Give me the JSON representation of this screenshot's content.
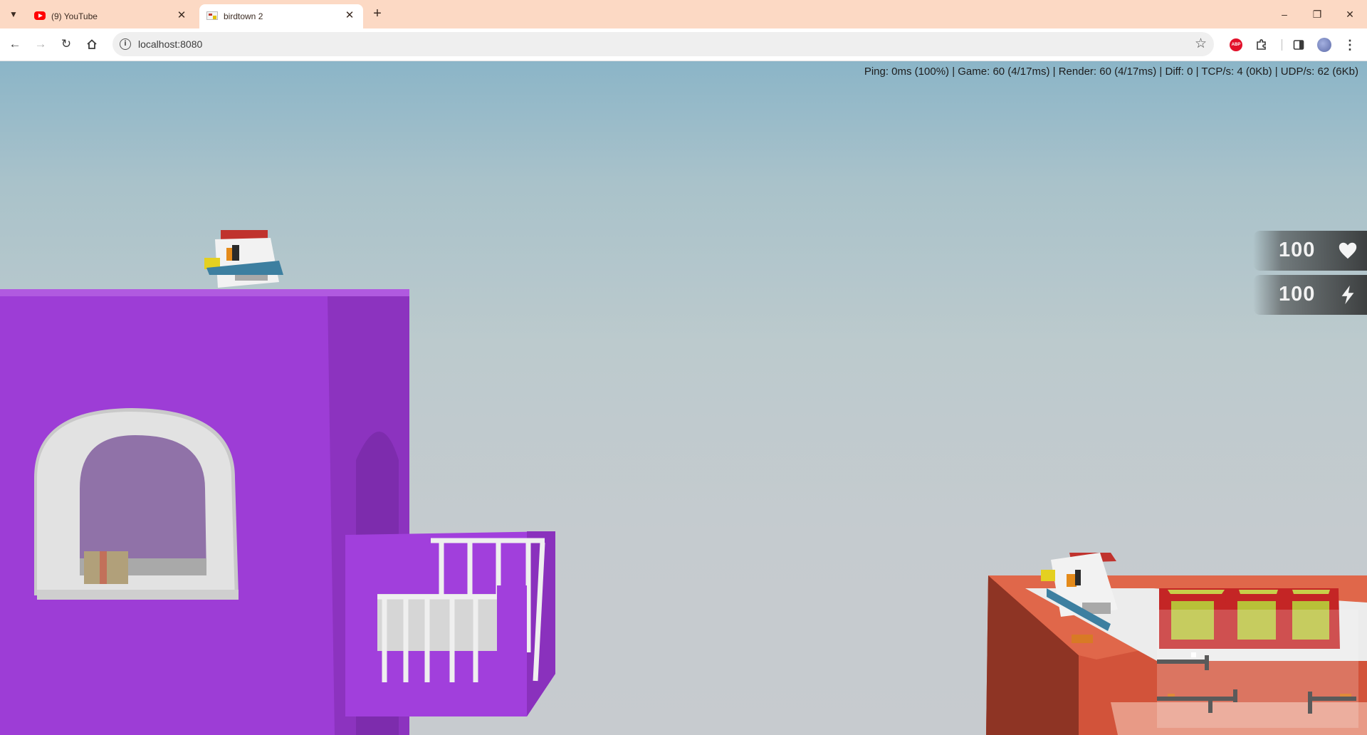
{
  "browser": {
    "tabs": [
      {
        "title": "(9) YouTube",
        "favicon": "youtube-favicon",
        "active": false
      },
      {
        "title": "birdtown 2",
        "favicon": "birdtown-favicon",
        "active": true
      }
    ],
    "new_tab_label": "+",
    "address": "localhost:8080",
    "window_controls": {
      "minimize": "–",
      "restore": "❐",
      "close": "✕"
    }
  },
  "game": {
    "debug_stats": "Ping: 0ms (100%) | Game: 60 (4/17ms) | Render: 60 (4/17ms) | Diff: 0 | TCP/s: 4 (0Kb) | UDP/s: 62 (6Kb)",
    "hud": {
      "health": {
        "value": "100",
        "icon": "heart-icon"
      },
      "energy": {
        "value": "100",
        "icon": "lightning-icon"
      }
    },
    "colors": {
      "purple_building": "#9a3bd3",
      "red_building": "#d2533a",
      "crate": "#c42525",
      "crate_panel": "#b8c038"
    }
  }
}
